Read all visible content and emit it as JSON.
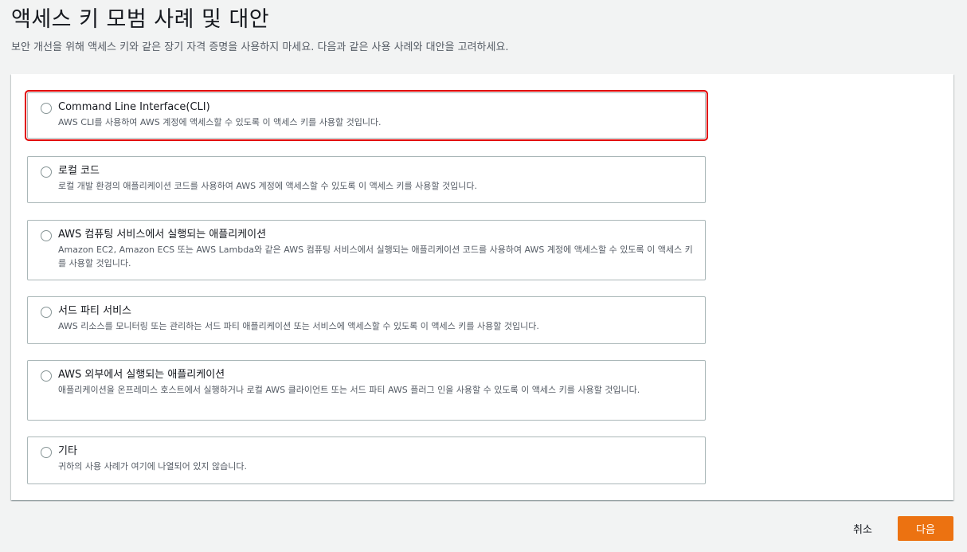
{
  "header": {
    "title": "액세스 키 모범 사례 및 대안",
    "description": "보안 개선을 위해 액세스 키와 같은 장기 자격 증명을 사용하지 마세요. 다음과 같은 사용 사례와 대안을 고려하세요."
  },
  "options": [
    {
      "label": "Command Line Interface(CLI)",
      "description": "AWS CLI를 사용하여 AWS 계정에 액세스할 수 있도록 이 액세스 키를 사용할 것입니다."
    },
    {
      "label": "로컬 코드",
      "description": "로컬 개발 환경의 애플리케이션 코드를 사용하여 AWS 계정에 액세스할 수 있도록 이 액세스 키를 사용할 것입니다."
    },
    {
      "label": "AWS 컴퓨팅 서비스에서 실행되는 애플리케이션",
      "description": "Amazon EC2, Amazon ECS 또는 AWS Lambda와 같은 AWS 컴퓨팅 서비스에서 실행되는 애플리케이션 코드를 사용하여 AWS 계정에 액세스할 수 있도록 이 액세스 키를 사용할 것입니다."
    },
    {
      "label": "서드 파티 서비스",
      "description": "AWS 리소스를 모니터링 또는 관리하는 서드 파티 애플리케이션 또는 서비스에 액세스할 수 있도록 이 액세스 키를 사용할 것입니다."
    },
    {
      "label": "AWS 외부에서 실행되는 애플리케이션",
      "description": "애플리케이션을 온프레미스 호스트에서 실행하거나 로컬 AWS 클라이언트 또는 서드 파티 AWS 플러그 인을 사용할 수 있도록 이 액세스 키를 사용할 것입니다."
    },
    {
      "label": "기타",
      "description": "귀하의 사용 사례가 여기에 나열되어 있지 않습니다."
    }
  ],
  "footer": {
    "cancel_label": "취소",
    "next_label": "다음"
  },
  "colors": {
    "primary_button": "#ec7211",
    "highlight_outline": "#e10000",
    "page_background": "#f2f3f3"
  }
}
